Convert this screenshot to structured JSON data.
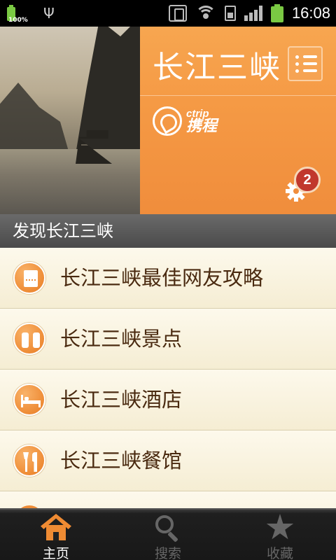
{
  "status_bar": {
    "battery_small_text": "100%",
    "time": "16:08"
  },
  "hero": {
    "title": "长江三峡",
    "logo": {
      "en": "ctrip",
      "cn": "携程"
    },
    "notification_count": "2"
  },
  "section": {
    "title": "发现长江三峡"
  },
  "list": {
    "items": [
      {
        "label": "长江三峡最佳网友攻略",
        "icon": "guide-book-icon"
      },
      {
        "label": "长江三峡景点",
        "icon": "binoculars-icon"
      },
      {
        "label": "长江三峡酒店",
        "icon": "bed-icon"
      },
      {
        "label": "长江三峡餐馆",
        "icon": "fork-knife-icon"
      }
    ]
  },
  "tab_bar": {
    "tabs": [
      {
        "label": "主页",
        "icon": "home-icon",
        "active": true
      },
      {
        "label": "搜索",
        "icon": "search-icon",
        "active": false
      },
      {
        "label": "收藏",
        "icon": "star-icon",
        "active": false
      }
    ]
  },
  "colors": {
    "accent_orange": "#f59a45",
    "list_text": "#4a2a10",
    "badge_red": "#c1382d",
    "section_header": "#555555"
  }
}
